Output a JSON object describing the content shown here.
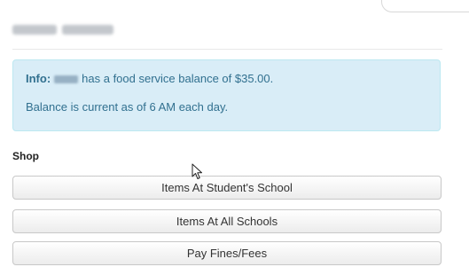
{
  "student": {
    "name_redacted": true
  },
  "info": {
    "label": "Info:",
    "balance_text": "has a food service balance of $35.00.",
    "current_text": "Balance is current as of 6 AM each day.",
    "colors": {
      "background": "#d9edf7",
      "border": "#bce8f1",
      "text": "#31708f"
    }
  },
  "shop": {
    "heading": "Shop",
    "buttons": [
      {
        "label": "Items At Student's School"
      },
      {
        "label": "Items At All Schools"
      },
      {
        "label": "Pay Fines/Fees"
      }
    ]
  },
  "cursor": {
    "icon": "mouse-pointer-icon"
  }
}
